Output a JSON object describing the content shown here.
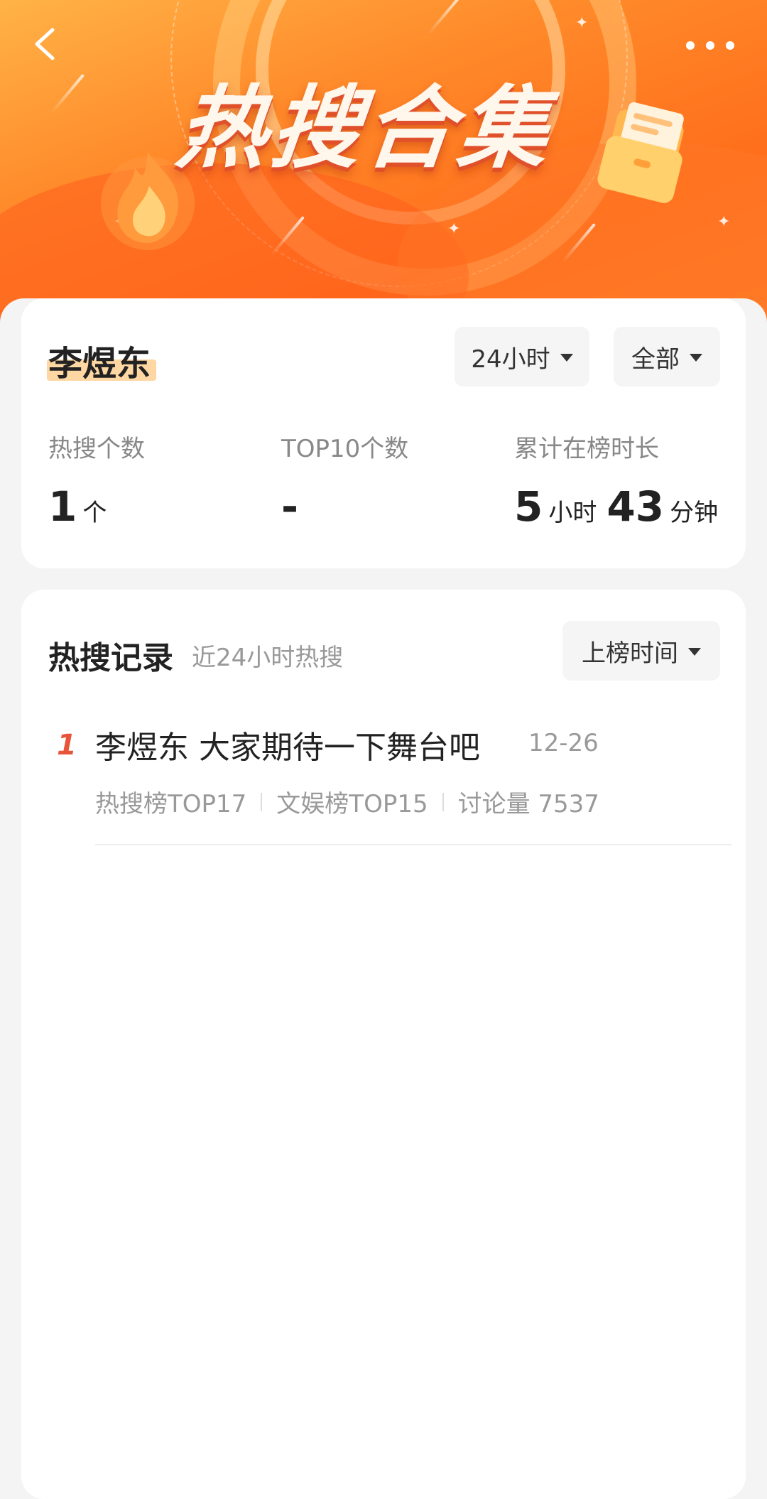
{
  "header": {
    "title": "热搜合集",
    "back_icon": "chevron-left-icon",
    "more_icon": "more-dots-icon"
  },
  "summary": {
    "name": "李煜东",
    "filters": {
      "time_label": "24小时",
      "scope_label": "全部"
    },
    "stats": [
      {
        "label": "热搜个数",
        "value": "1",
        "unit": "个"
      },
      {
        "label": "TOP10个数",
        "value": "-"
      },
      {
        "label": "累计在榜时长",
        "hours": "5",
        "hours_unit": "小时",
        "minutes": "43",
        "minutes_unit": "分钟"
      }
    ]
  },
  "records": {
    "title": "热搜记录",
    "subtitle": "近24小时热搜",
    "sort_label": "上榜时间",
    "items": [
      {
        "rank": "1",
        "title": "李煜东 大家期待一下舞台吧",
        "date": "12-26",
        "meta": [
          "热搜榜TOP17",
          "文娱榜TOP15",
          "讨论量 7537"
        ]
      }
    ]
  },
  "colors": {
    "accent": "#ff7a24",
    "rank": "#e8543a",
    "highlight": "#ffd7a3"
  }
}
